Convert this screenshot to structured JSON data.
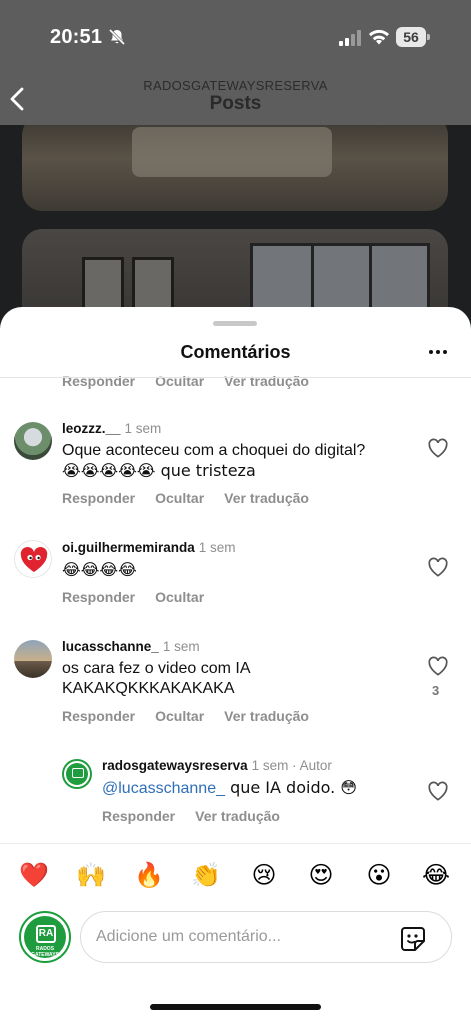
{
  "status": {
    "time": "20:51",
    "battery": "56"
  },
  "header": {
    "account": "RADOSGATEWAYSRESERVA",
    "title": "Posts"
  },
  "sheet": {
    "title": "Comentários"
  },
  "partial_actions": [
    "Responder",
    "Ocultar",
    "Ver tradução"
  ],
  "comments": [
    {
      "username": "leozzz.__",
      "ago": "1 sem",
      "text": "Oque aconteceu com a choquei do digital?",
      "text2": "😭😭😭😭😭 que tristeza",
      "actions": [
        "Responder",
        "Ocultar",
        "Ver tradução"
      ]
    },
    {
      "username": "oi.guilhermemiranda",
      "ago": "1 sem",
      "text": "😂😂😂😂",
      "actions": [
        "Responder",
        "Ocultar"
      ]
    },
    {
      "username": "lucasschanne_",
      "ago": "1 sem",
      "text": "os cara fez o video com IA",
      "text2": "KAKAKQKKKAKAKAKA",
      "like_count": "3",
      "actions": [
        "Responder",
        "Ocultar",
        "Ver tradução"
      ]
    },
    {
      "username": "radosgatewaysreserva",
      "ago": "1 sem",
      "author": "· Autor",
      "mention": "@lucasschanne_",
      "text": " que IA doido. 😳",
      "actions": [
        "Responder",
        "Ver tradução"
      ]
    }
  ],
  "reactions": [
    "❤️",
    "🙌",
    "🔥",
    "👏",
    "😢",
    "😍",
    "😮",
    "😂"
  ],
  "composer": {
    "placeholder": "Adicione um comentário...",
    "avatar_label": "RA",
    "avatar_sub": "RADOS GATEWAYS"
  },
  "colors": {
    "like_red": "#e0242f",
    "brand_green": "#1e9c3e",
    "mention_blue": "#2f6fb8"
  },
  "icons": [
    "back-chevron-icon",
    "bell-slash-icon",
    "signal-icon",
    "wifi-icon",
    "battery-icon",
    "more-icon",
    "heart-outline-icon",
    "sticker-icon"
  ]
}
